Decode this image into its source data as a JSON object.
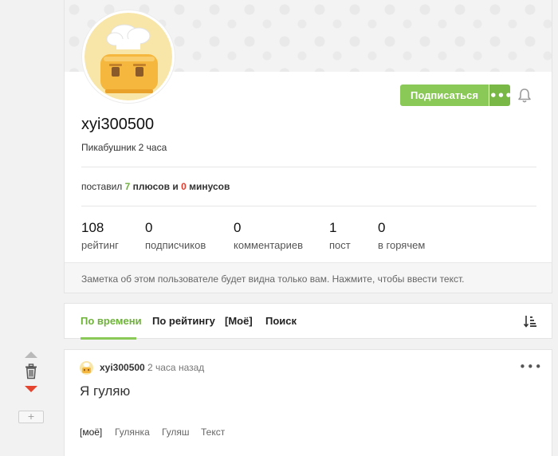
{
  "profile": {
    "username": "xyi300500",
    "meta": "Пикабушник 2 часа",
    "subscribe_label": "Подписаться",
    "more_label": "•••",
    "votes": {
      "prefix": "поставил",
      "plus_count": "7",
      "plus_word": "плюсов",
      "conj": "и",
      "minus_count": "0",
      "minus_word": "минусов"
    },
    "stats": [
      {
        "value": "108",
        "label": "рейтинг"
      },
      {
        "value": "0",
        "label": "подписчиков"
      },
      {
        "value": "0",
        "label": "комментариев"
      },
      {
        "value": "1",
        "label": "пост"
      },
      {
        "value": "0",
        "label": "в горячем"
      }
    ],
    "note_placeholder": "Заметка об этом пользователе будет видна только вам. Нажмите, чтобы ввести текст."
  },
  "tabs": [
    {
      "label": "По времени",
      "active": true
    },
    {
      "label": "По рейтингу",
      "active": false
    },
    {
      "label": "[Моё]",
      "active": false
    },
    {
      "label": "Поиск",
      "active": false
    }
  ],
  "rail": {
    "expand_label": "+"
  },
  "post": {
    "author": "xyi300500",
    "time": "2 часа назад",
    "more_label": "•••",
    "title": "Я гуляю",
    "tags": [
      "[моё]",
      "Гулянка",
      "Гуляш",
      "Текст"
    ]
  },
  "colors": {
    "accent_green": "#8ac858",
    "plus_green": "#6fb23b",
    "minus_red": "#e03c2d"
  },
  "icons": [
    "bell-icon",
    "sort-icon",
    "trash-icon",
    "vote-up-arrow",
    "vote-down-arrow",
    "toaster-avatar"
  ]
}
